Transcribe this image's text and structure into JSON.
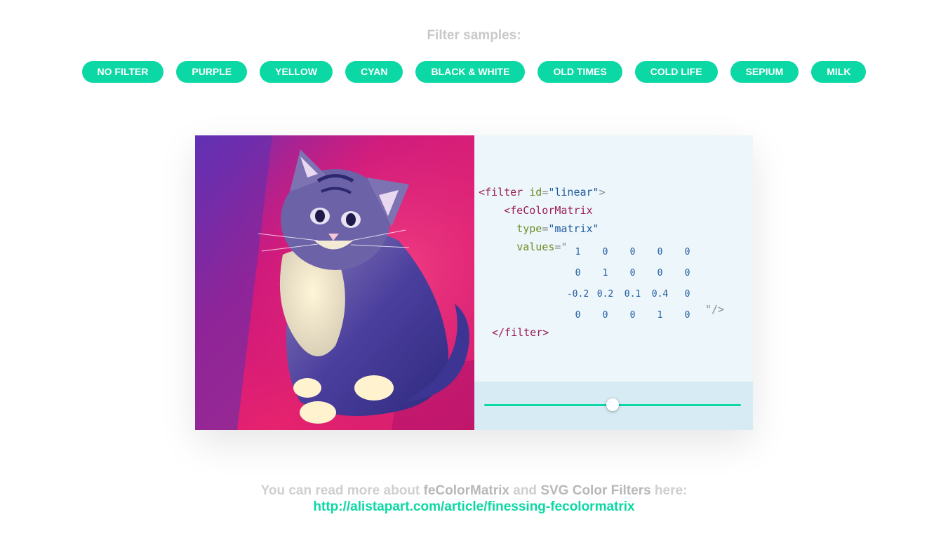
{
  "header": {
    "title": "Filter samples:"
  },
  "filters": [
    {
      "label": "NO FILTER"
    },
    {
      "label": "PURPLE"
    },
    {
      "label": "YELLOW"
    },
    {
      "label": "CYAN"
    },
    {
      "label": "BLACK & WHITE"
    },
    {
      "label": "OLD TIMES"
    },
    {
      "label": "COLD LIFE"
    },
    {
      "label": "SEPIUM"
    },
    {
      "label": "MILK"
    }
  ],
  "code": {
    "filter_open_tag": "<filter",
    "id_attr": "id",
    "id_value": "\"linear\"",
    "fe_tag": "<feColorMatrix",
    "type_attr": "type",
    "type_value": "\"matrix\"",
    "values_attr": "values",
    "values_open_quote": "\"",
    "matrix": [
      [
        "1",
        "0",
        "0",
        "0",
        "0"
      ],
      [
        "0",
        "1",
        "0",
        "0",
        "0"
      ],
      [
        "-0.2",
        "0.2",
        "0.1",
        "0.4",
        "0"
      ],
      [
        "0",
        "0",
        "0",
        "1",
        "0"
      ]
    ],
    "values_close": "\"/>",
    "filter_close_tag": "</filter>"
  },
  "slider": {
    "value": 0.5
  },
  "colors": {
    "accent": "#0bd8a4",
    "code_bg": "#ecf6fb",
    "slider_bg": "#d7ebf4"
  },
  "image": {
    "description_icon": "kitten-photo"
  },
  "footer": {
    "text_prefix": "You can read more about ",
    "term1": "feColorMatrix",
    "text_middle": " and ",
    "term2": "SVG Color Filters",
    "text_suffix": " here:",
    "link": "http://alistapart.com/article/finessing-fecolormatrix"
  }
}
